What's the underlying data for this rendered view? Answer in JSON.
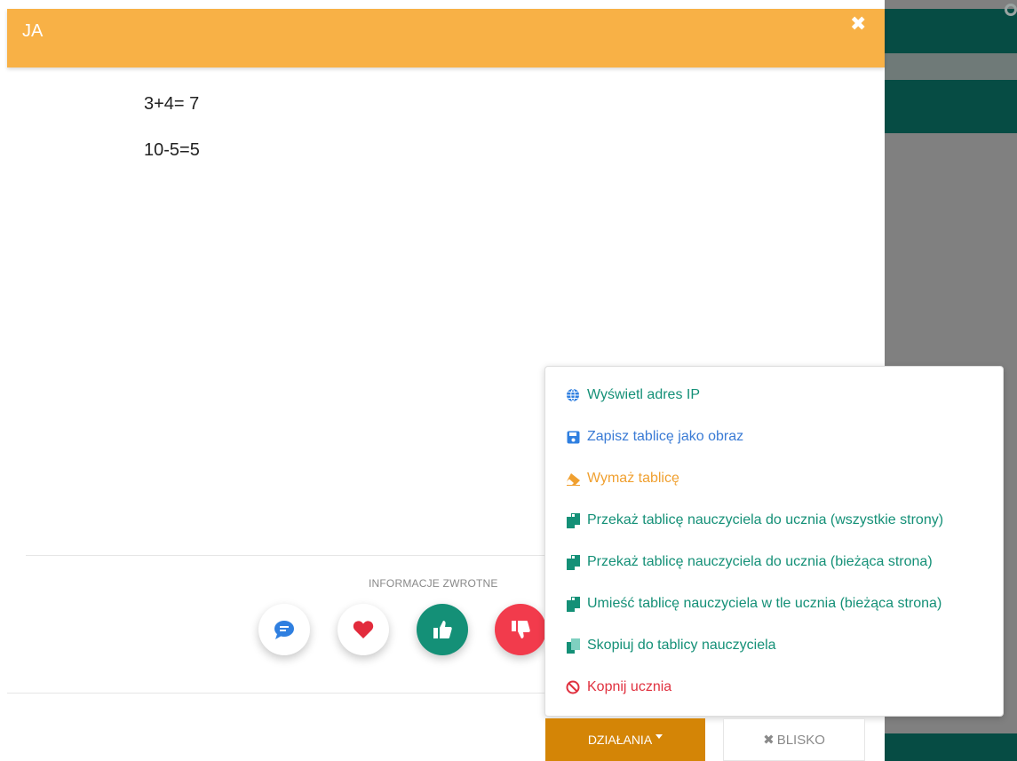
{
  "modal": {
    "title": "JA",
    "close_icon": "close-icon",
    "board_lines": [
      "3+4= 7",
      "10-5=5"
    ]
  },
  "feedback": {
    "label": "INFORMACJE ZWROTNE",
    "buttons": [
      {
        "icon": "comment-icon",
        "color": "#ffffff"
      },
      {
        "icon": "heart-icon",
        "color": "#ffffff"
      },
      {
        "icon": "thumbs-up-icon",
        "color": "#149077"
      },
      {
        "icon": "thumbs-down-icon",
        "color": "#f23b4c"
      }
    ]
  },
  "dropdown": {
    "items": [
      {
        "label": "Wyświetl adres IP",
        "icon": "globe-icon",
        "color": "#149077"
      },
      {
        "label": "Zapisz tablicę jako obraz",
        "icon": "save-icon",
        "color": "#3a7bd5"
      },
      {
        "label": "Wymaż tablicę",
        "icon": "eraser-icon",
        "color": "#f0a030"
      },
      {
        "label": "Przekaż tablicę nauczyciela do ucznia (wszystkie strony)",
        "icon": "copy-icon",
        "color": "#149077"
      },
      {
        "label": "Przekaż tablicę nauczyciela do ucznia (bieżąca strona)",
        "icon": "copy-icon",
        "color": "#149077"
      },
      {
        "label": "Umieść tablicę nauczyciela w tle ucznia (bieżąca strona)",
        "icon": "copy-icon",
        "color": "#149077"
      },
      {
        "label": "Skopiuj do tablicy nauczyciela",
        "icon": "copy-outline-icon",
        "color": "#149077"
      },
      {
        "label": "Kopnij ucznia",
        "icon": "ban-icon",
        "color": "#e0313f"
      }
    ]
  },
  "footer": {
    "actions_label": "DZIAŁANIA",
    "close_label": "BLISKO"
  },
  "colors": {
    "header": "#f8b146",
    "actions_button": "#d48506",
    "background_dark": "#064c44"
  }
}
